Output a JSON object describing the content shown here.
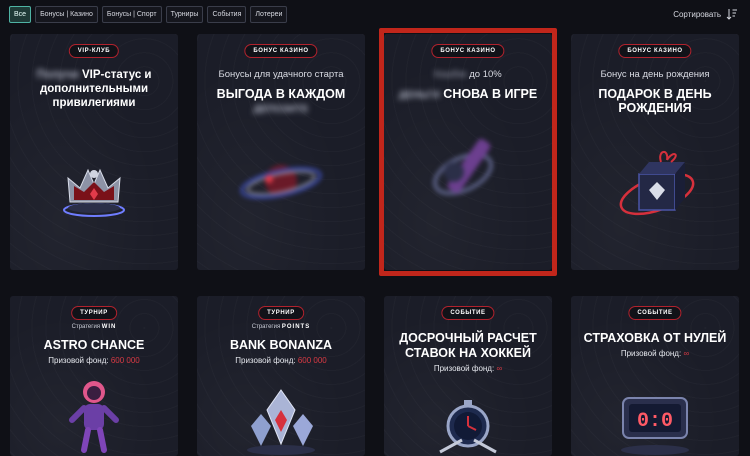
{
  "filters": [
    {
      "label": "Все",
      "active": true
    },
    {
      "label": "Бонусы | Казино",
      "active": false
    },
    {
      "label": "Бонусы | Спорт",
      "active": false
    },
    {
      "label": "Турниры",
      "active": false
    },
    {
      "label": "События",
      "active": false
    },
    {
      "label": "Лотереи",
      "active": false
    }
  ],
  "sort": {
    "label": "Сортировать",
    "icon": "sort-icon"
  },
  "colors": {
    "accent_red": "#d83a44",
    "badge_border": "#b1222d",
    "active_chip": "#4fb3a4",
    "highlight": "#c1261b"
  },
  "cards": [
    {
      "badge": "VIP-КЛУБ",
      "title_blur": "Получи",
      "title_lines": [
        "VIP-статус и",
        "дополнительными",
        "привилегиями"
      ],
      "art": "crown-icon"
    },
    {
      "badge": "БОНУС КАЗИНО",
      "subtitle": "Бонусы для удачного старта",
      "title": "ВЫГОДА В КАЖДОМ",
      "title_blur": "ДЕПОЗИТЕ",
      "art": "planet-ring-icon"
    },
    {
      "badge": "БОНУС КАЗИНО",
      "subtitle_blur": "Кэшбэк",
      "subtitle": "до 10%",
      "title_blur": "ДЕНЬГИ",
      "title": "СНОВА В ИГРЕ",
      "art": "orbit-icon",
      "highlighted": true
    },
    {
      "badge": "БОНУС КАЗИНО",
      "subtitle": "Бонус на день рождения",
      "title_lines": [
        "ПОДАРОК В ДЕНЬ",
        "РОЖДЕНИЯ"
      ],
      "art": "gift-box-icon"
    },
    {
      "badge": "ТУРНИР",
      "strategy_label": "Стратегия",
      "strategy": "WIN",
      "title": "ASTRO CHANCE",
      "prize_label": "Призовой фонд:",
      "prize": "600 000",
      "art": "astronaut-icon"
    },
    {
      "badge": "ТУРНИР",
      "strategy_label": "Стратегия",
      "strategy": "POINTS",
      "title": "BANK BONANZA",
      "prize_label": "Призовой фонд:",
      "prize": "600 000",
      "art": "gems-icon"
    },
    {
      "badge": "СОБЫТИЕ",
      "title_lines": [
        "ДОСРОЧНЫЙ РАСЧЕТ",
        "СТАВОК НА ХОККЕЙ"
      ],
      "prize_label": "Призовой фонд:",
      "prize": "∞",
      "art": "hockey-stopwatch-icon"
    },
    {
      "badge": "СОБЫТИЕ",
      "title": "СТРАХОВКА ОТ НУЛЕЙ",
      "prize_label": "Призовой фонд:",
      "prize": "∞",
      "scoreboard": "0:0",
      "art": "scoreboard-icon"
    }
  ]
}
